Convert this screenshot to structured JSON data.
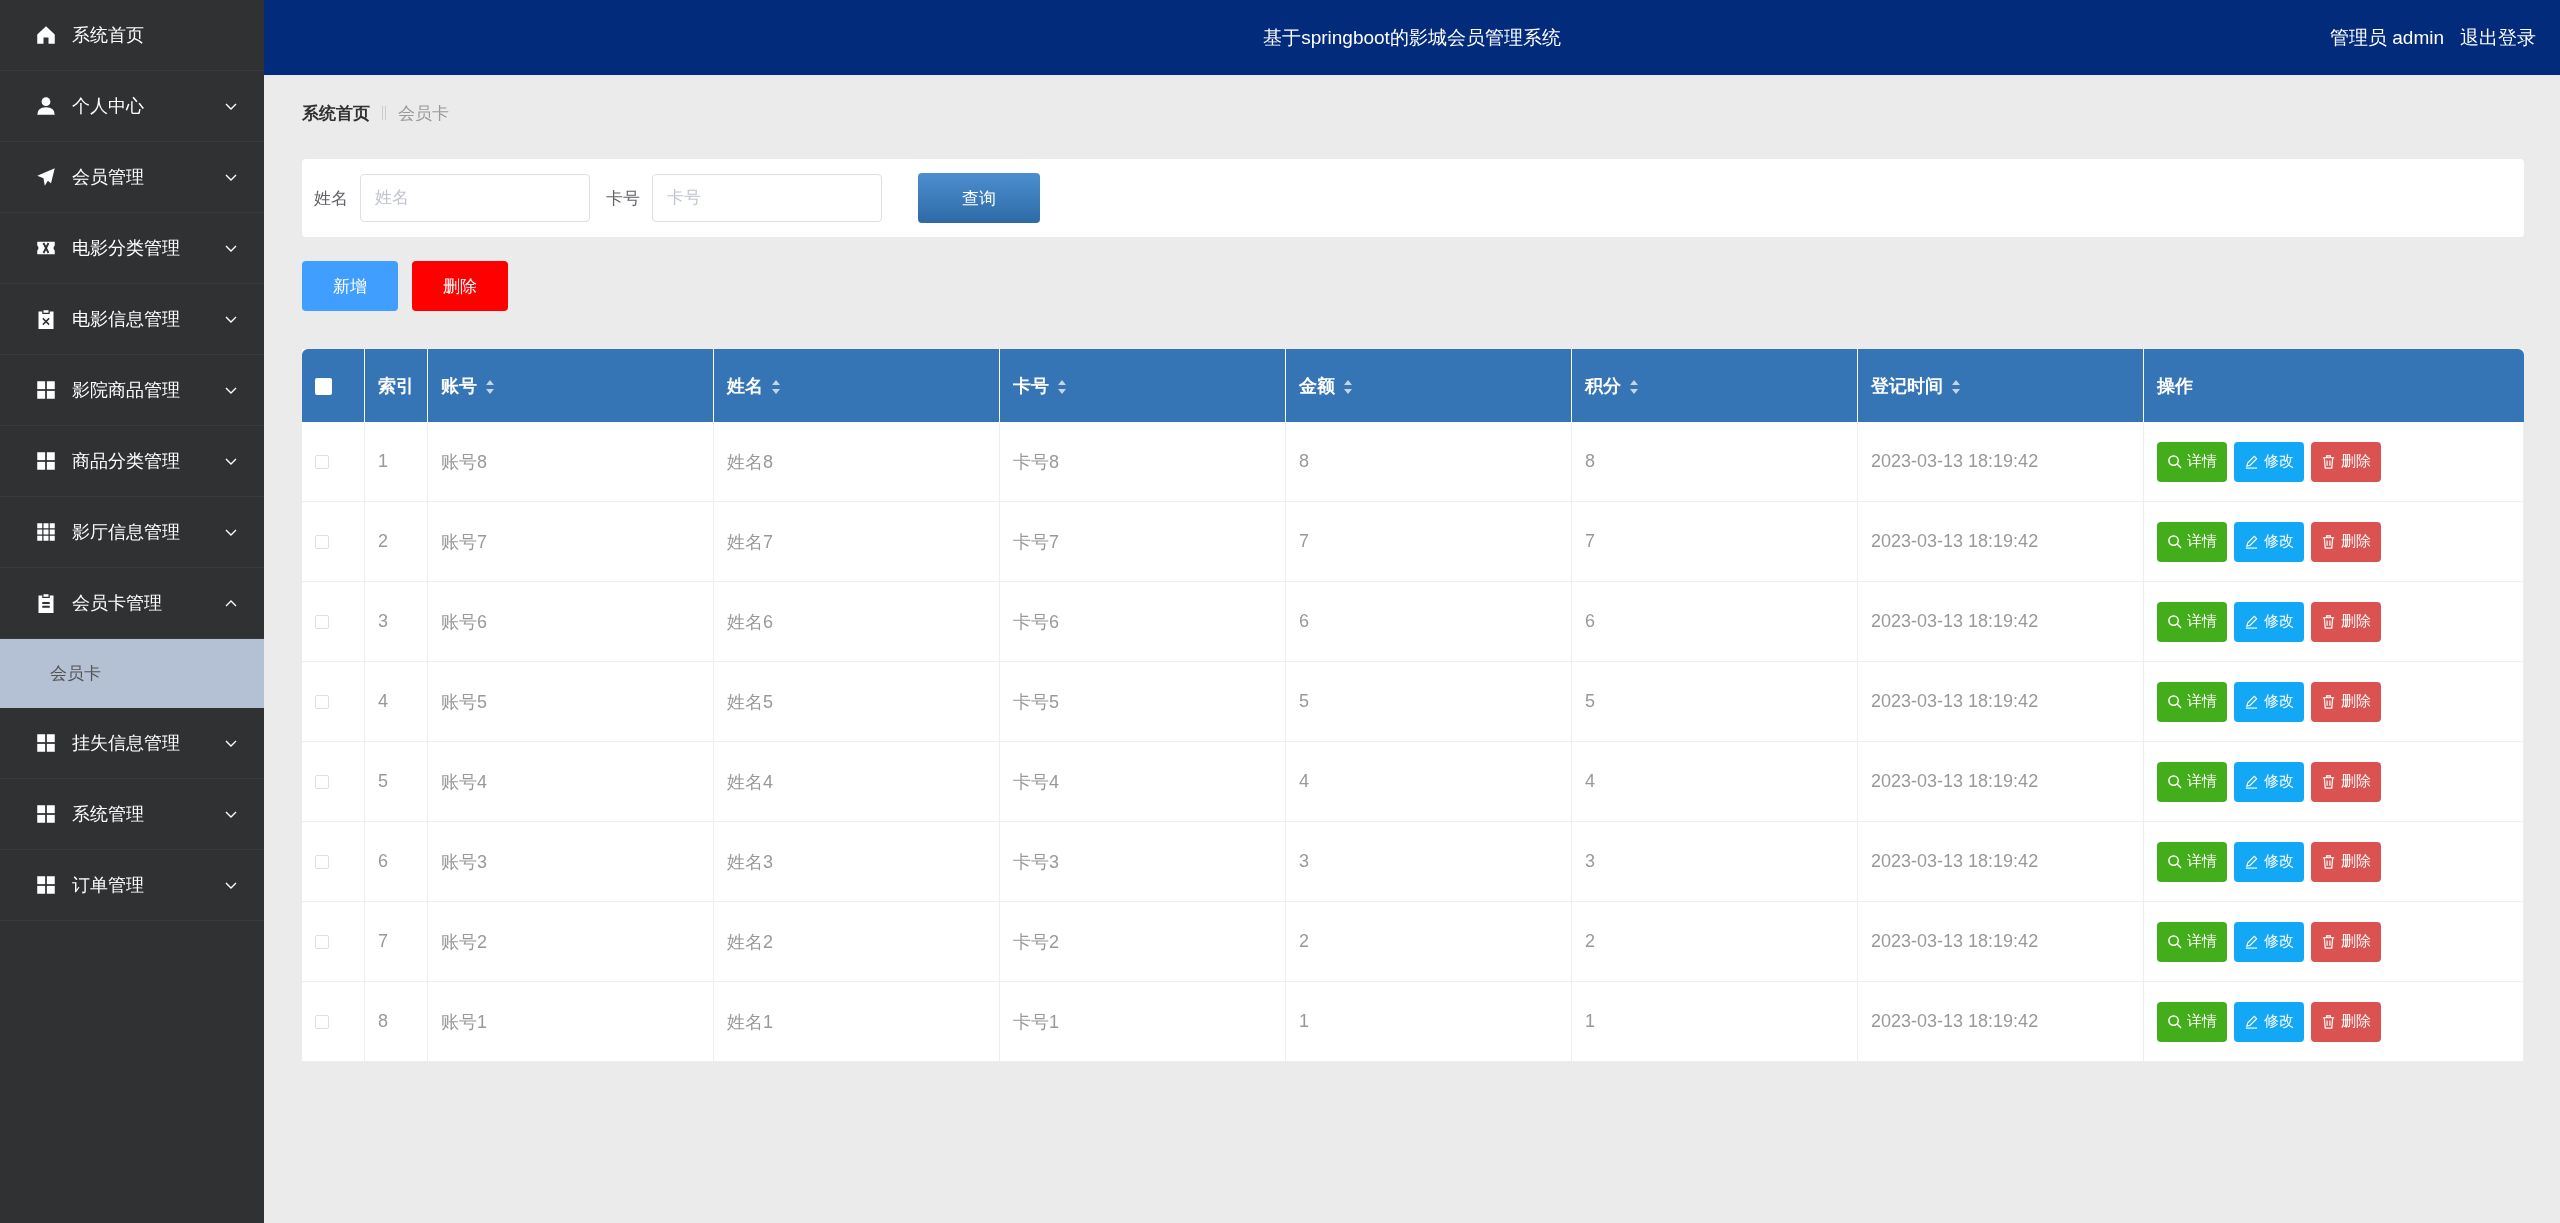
{
  "header": {
    "title": "基于springboot的影城会员管理系统",
    "user": "管理员 admin",
    "logout": "退出登录"
  },
  "sidebar": {
    "items": [
      {
        "label": "系统首页",
        "has_caret": false
      },
      {
        "label": "个人中心",
        "has_caret": true,
        "expanded": false
      },
      {
        "label": "会员管理",
        "has_caret": true,
        "expanded": false
      },
      {
        "label": "电影分类管理",
        "has_caret": true,
        "expanded": false
      },
      {
        "label": "电影信息管理",
        "has_caret": true,
        "expanded": false
      },
      {
        "label": "影院商品管理",
        "has_caret": true,
        "expanded": false
      },
      {
        "label": "商品分类管理",
        "has_caret": true,
        "expanded": false
      },
      {
        "label": "影厅信息管理",
        "has_caret": true,
        "expanded": false
      },
      {
        "label": "会员卡管理",
        "has_caret": true,
        "expanded": true,
        "children": [
          {
            "label": "会员卡",
            "selected": true
          }
        ]
      },
      {
        "label": "挂失信息管理",
        "has_caret": true,
        "expanded": false
      },
      {
        "label": "系统管理",
        "has_caret": true,
        "expanded": false
      },
      {
        "label": "订单管理",
        "has_caret": true,
        "expanded": false
      }
    ]
  },
  "breadcrumb": [
    "系统首页",
    "会员卡"
  ],
  "search": {
    "fields": [
      {
        "label": "姓名",
        "placeholder": "姓名"
      },
      {
        "label": "卡号",
        "placeholder": "卡号"
      }
    ],
    "button": "查询"
  },
  "toolbar": [
    {
      "kind": "add",
      "label": "新增"
    },
    {
      "kind": "delete",
      "label": "删除"
    }
  ],
  "table": {
    "all_checked": false,
    "columns": [
      {
        "label": "索引",
        "sortable": false
      },
      {
        "label": "账号",
        "sortable": true
      },
      {
        "label": "姓名",
        "sortable": true
      },
      {
        "label": "卡号",
        "sortable": true
      },
      {
        "label": "金额",
        "sortable": true
      },
      {
        "label": "积分",
        "sortable": true
      },
      {
        "label": "登记时间",
        "sortable": true
      },
      {
        "label": "操作",
        "sortable": false
      }
    ],
    "rows": [
      {
        "checked": false,
        "cells": [
          "1",
          "账号8",
          "姓名8",
          "卡号8",
          "8",
          "8",
          "2023-03-13 18:19:42"
        ],
        "actions": [
          {
            "kind": "detail",
            "label": "详情"
          },
          {
            "kind": "edit",
            "label": "修改"
          },
          {
            "kind": "delete",
            "label": "删除"
          }
        ]
      },
      {
        "checked": false,
        "cells": [
          "2",
          "账号7",
          "姓名7",
          "卡号7",
          "7",
          "7",
          "2023-03-13 18:19:42"
        ],
        "actions": [
          {
            "kind": "detail",
            "label": "详情"
          },
          {
            "kind": "edit",
            "label": "修改"
          },
          {
            "kind": "delete",
            "label": "删除"
          }
        ]
      },
      {
        "checked": false,
        "cells": [
          "3",
          "账号6",
          "姓名6",
          "卡号6",
          "6",
          "6",
          "2023-03-13 18:19:42"
        ],
        "actions": [
          {
            "kind": "detail",
            "label": "详情"
          },
          {
            "kind": "edit",
            "label": "修改"
          },
          {
            "kind": "delete",
            "label": "删除"
          }
        ]
      },
      {
        "checked": false,
        "cells": [
          "4",
          "账号5",
          "姓名5",
          "卡号5",
          "5",
          "5",
          "2023-03-13 18:19:42"
        ],
        "actions": [
          {
            "kind": "detail",
            "label": "详情"
          },
          {
            "kind": "edit",
            "label": "修改"
          },
          {
            "kind": "delete",
            "label": "删除"
          }
        ]
      },
      {
        "checked": false,
        "cells": [
          "5",
          "账号4",
          "姓名4",
          "卡号4",
          "4",
          "4",
          "2023-03-13 18:19:42"
        ],
        "actions": [
          {
            "kind": "detail",
            "label": "详情"
          },
          {
            "kind": "edit",
            "label": "修改"
          },
          {
            "kind": "delete",
            "label": "删除"
          }
        ]
      },
      {
        "checked": false,
        "cells": [
          "6",
          "账号3",
          "姓名3",
          "卡号3",
          "3",
          "3",
          "2023-03-13 18:19:42"
        ],
        "actions": [
          {
            "kind": "detail",
            "label": "详情"
          },
          {
            "kind": "edit",
            "label": "修改"
          },
          {
            "kind": "delete",
            "label": "删除"
          }
        ]
      },
      {
        "checked": false,
        "cells": [
          "7",
          "账号2",
          "姓名2",
          "卡号2",
          "2",
          "2",
          "2023-03-13 18:19:42"
        ],
        "actions": [
          {
            "kind": "detail",
            "label": "详情"
          },
          {
            "kind": "edit",
            "label": "修改"
          },
          {
            "kind": "delete",
            "label": "删除"
          }
        ]
      },
      {
        "checked": false,
        "cells": [
          "8",
          "账号1",
          "姓名1",
          "卡号1",
          "1",
          "1",
          "2023-03-13 18:19:42"
        ],
        "actions": [
          {
            "kind": "detail",
            "label": "详情"
          },
          {
            "kind": "edit",
            "label": "修改"
          },
          {
            "kind": "delete",
            "label": "删除"
          }
        ]
      }
    ]
  }
}
